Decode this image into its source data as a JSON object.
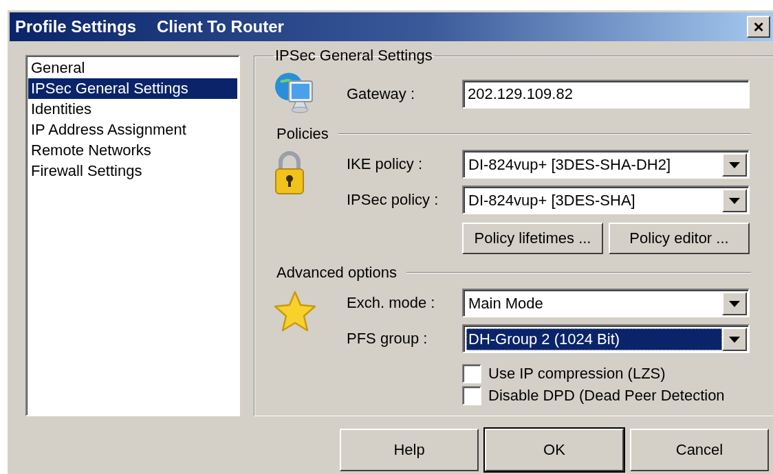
{
  "window": {
    "title": "Profile Settings",
    "subtitle": "Client To Router",
    "close_label": "×"
  },
  "sidebar": {
    "items": [
      {
        "label": "General",
        "selected": false
      },
      {
        "label": "IPSec General Settings",
        "selected": true
      },
      {
        "label": "Identities",
        "selected": false
      },
      {
        "label": "IP Address Assignment",
        "selected": false
      },
      {
        "label": "Remote Networks",
        "selected": false
      },
      {
        "label": "Firewall Settings",
        "selected": false
      }
    ]
  },
  "group": {
    "title": "IPSec General Settings",
    "sections": [
      {
        "rows": [
          {
            "kind": "field",
            "label": "Gateway :",
            "value": "202.129.109.82"
          }
        ]
      },
      {
        "heading": "Policies",
        "rows": [
          {
            "kind": "combo",
            "label": "IKE policy :",
            "value": "DI-824vup+ [3DES-SHA-DH2]",
            "focused": false
          },
          {
            "kind": "combo",
            "label": "IPSec policy :",
            "value": "DI-824vup+ [3DES-SHA]",
            "focused": false
          },
          {
            "kind": "buttons",
            "buttons": [
              "Policy lifetimes ...",
              "Policy editor ..."
            ]
          }
        ]
      },
      {
        "heading": "Advanced options",
        "rows": [
          {
            "kind": "combo",
            "label": "Exch. mode :",
            "value": "Main Mode",
            "focused": false
          },
          {
            "kind": "combo",
            "label": "PFS group :",
            "value": "DH-Group 2 (1024 Bit)",
            "focused": true
          },
          {
            "kind": "checkbox",
            "label": "Use IP compression (LZS)",
            "checked": false
          },
          {
            "kind": "checkbox",
            "label": "Disable DPD (Dead Peer Detection",
            "checked": false
          }
        ]
      }
    ]
  },
  "buttons": [
    {
      "label": "Help",
      "default": false
    },
    {
      "label": "OK",
      "default": true
    },
    {
      "label": "Cancel",
      "default": false
    }
  ]
}
